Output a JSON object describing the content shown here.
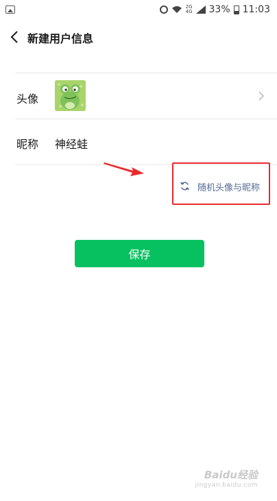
{
  "status_bar": {
    "battery_percent": "33%",
    "time": "11:03",
    "net_top": "2G",
    "net_bottom": "4G"
  },
  "header": {
    "title": "新建用户信息"
  },
  "form": {
    "avatar_label": "头像",
    "nickname_label": "昵称",
    "nickname_value": "神经蛙"
  },
  "random_action": {
    "label": "随机头像与昵称"
  },
  "save_button": {
    "label": "保存"
  },
  "colors": {
    "accent_green": "#07c160",
    "link_blue": "#526a96",
    "highlight_red": "#e8292b"
  },
  "watermark": {
    "main": "Baidu经验",
    "sub": "jingyan.baidu.com"
  }
}
